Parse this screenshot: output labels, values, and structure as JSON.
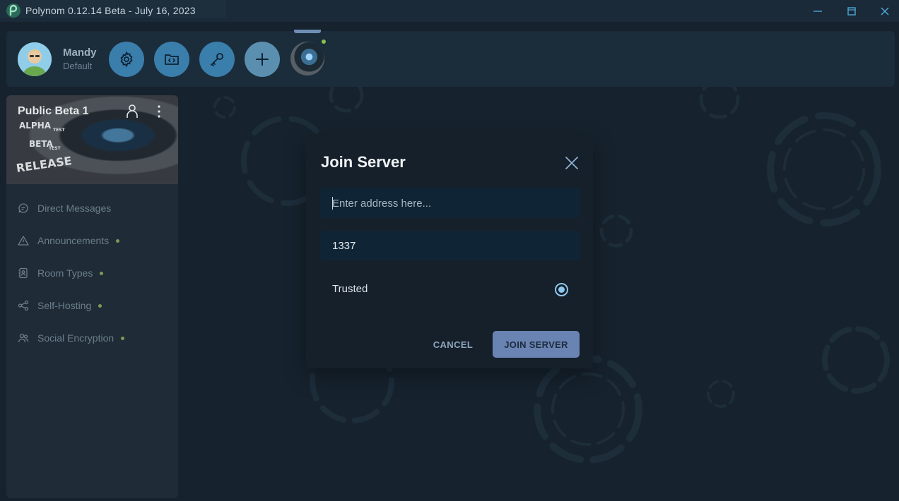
{
  "window": {
    "title": "Polynom 0.12.14 Beta  -  July 16, 2023",
    "minimize_icon": "minimize-icon",
    "maximize_icon": "maximize-icon",
    "close_icon": "close-icon"
  },
  "profile": {
    "name": "Mandy",
    "status": "Default",
    "buttons": [
      {
        "icon": "gear-icon"
      },
      {
        "icon": "folder-code-icon"
      },
      {
        "icon": "key-icon"
      },
      {
        "icon": "plus-icon"
      }
    ]
  },
  "server": {
    "name": "Public Beta 1",
    "banner_labels": [
      "ALPHA",
      "TEST",
      "BETA",
      "TEST",
      "RELEASE"
    ]
  },
  "nav": {
    "items": [
      {
        "label": "Direct Messages",
        "icon": "message-icon",
        "unread": false
      },
      {
        "label": "Announcements",
        "icon": "warning-icon",
        "unread": true
      },
      {
        "label": "Room Types",
        "icon": "contacts-icon",
        "unread": true
      },
      {
        "label": "Self-Hosting",
        "icon": "share-icon",
        "unread": true
      },
      {
        "label": "Social Encryption",
        "icon": "people-icon",
        "unread": true
      }
    ]
  },
  "dialog": {
    "title": "Join Server",
    "address_placeholder": "Enter address here...",
    "address_value": "",
    "port_value": "1337",
    "trusted_label": "Trusted",
    "trusted_checked": true,
    "cancel_label": "CANCEL",
    "join_label": "JOIN SERVER"
  },
  "colors": {
    "accent": "#3a7eab",
    "join_button": "#6984b3",
    "unread_dot": "#7e9a56"
  }
}
